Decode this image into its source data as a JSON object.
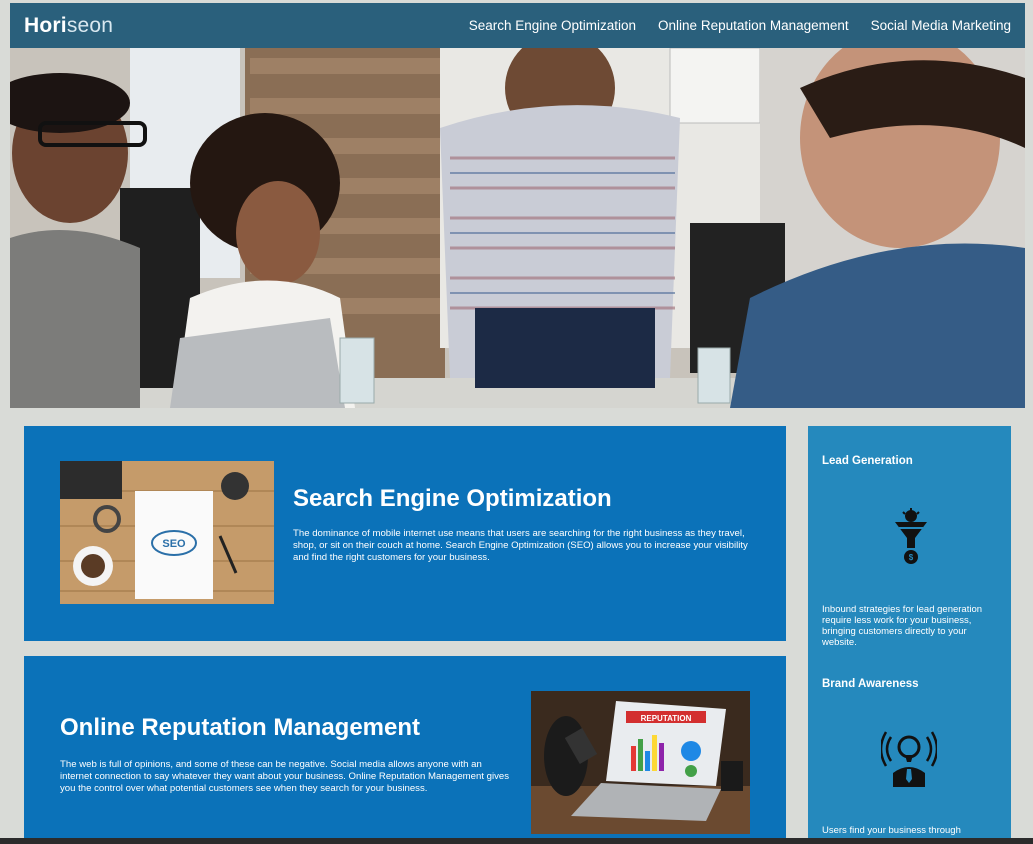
{
  "header": {
    "logo_main": "Hori",
    "logo_rest": "seon",
    "nav": [
      {
        "label": "Search Engine Optimization"
      },
      {
        "label": "Online Reputation Management"
      },
      {
        "label": "Social Media Marketing"
      }
    ]
  },
  "seo": {
    "title": "Search Engine Optimization",
    "body": "The dominance of mobile internet use means that users are searching for the right business as they travel, shop, or sit on their couch at home. Search Engine Optimization (SEO) allows you to increase your visibility and find the right customers for your business.",
    "image_text": "SEO"
  },
  "orm": {
    "title": "Online Reputation Management",
    "body": "The web is full of opinions, and some of these can be negative. Social media allows anyone with an internet connection to say whatever they want about your business. Online Reputation Management gives you the control over what potential customers see when they search for your business.",
    "image_text": "REPUTATION"
  },
  "sidebar": {
    "lead_title": "Lead Generation",
    "lead_body": "Inbound strategies for lead generation require less work for your business, bringing customers directly to your website.",
    "brand_title": "Brand Awareness",
    "brand_body": "Users find your business through"
  },
  "colors": {
    "header_bg": "#2a607c",
    "card_bg": "#0b72b9",
    "sidebar_bg": "#2589bd",
    "page_bg": "#d9dbd7"
  },
  "icons": [
    "lead-funnel-icon",
    "brand-awareness-icon"
  ]
}
